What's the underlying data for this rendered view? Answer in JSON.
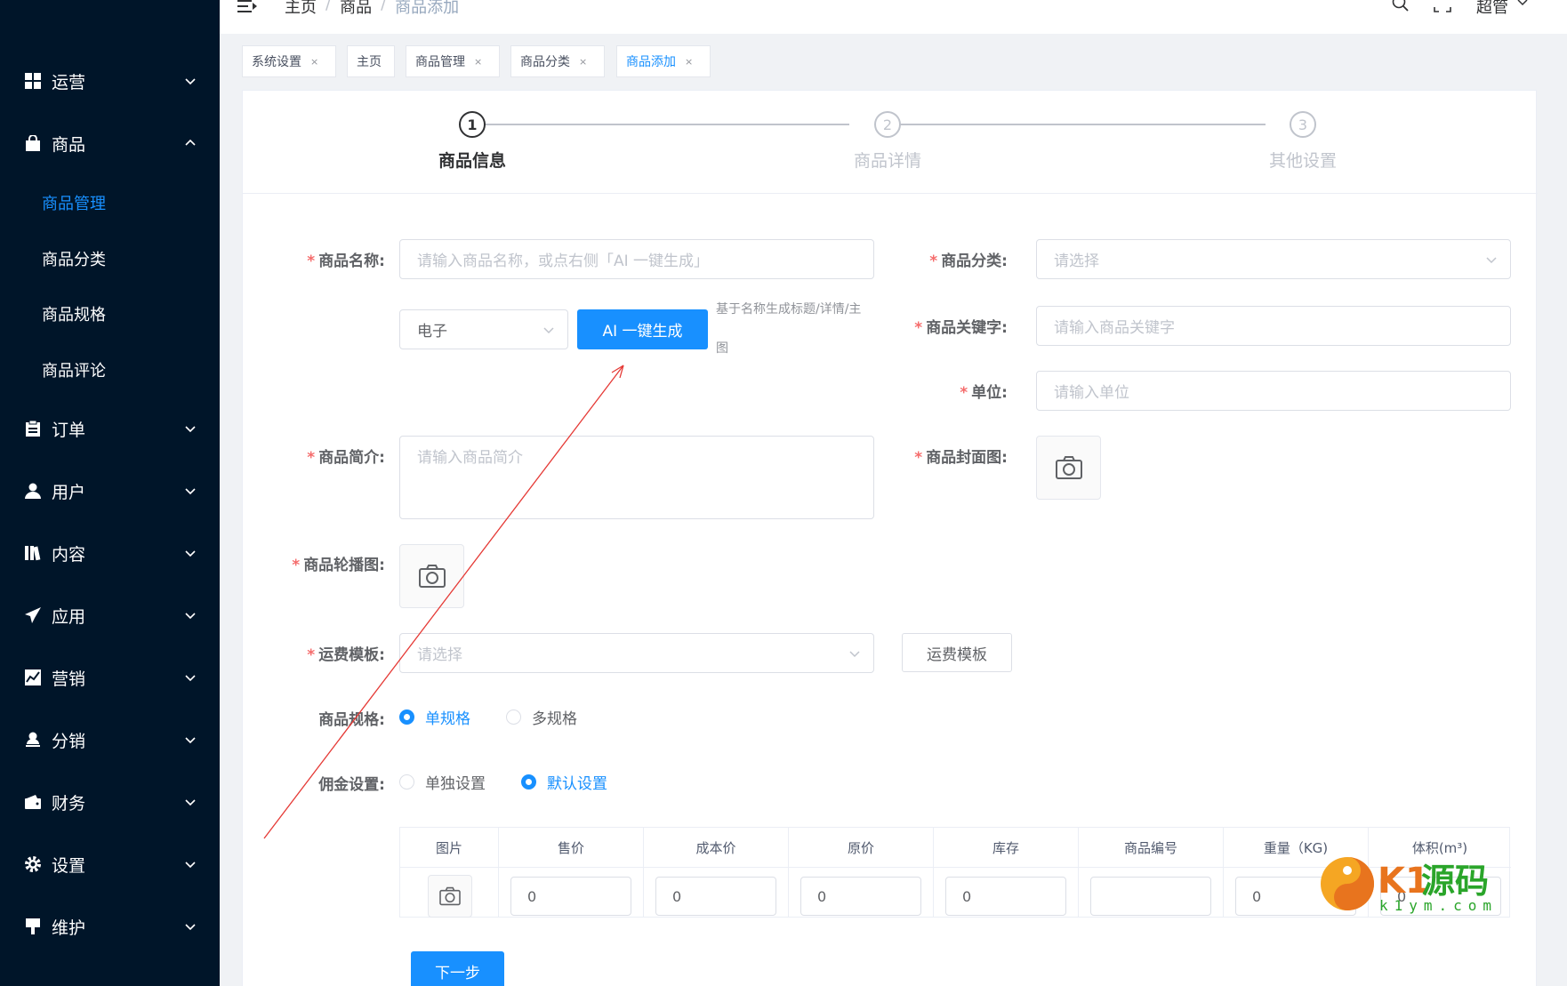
{
  "sidebar": {
    "menus": [
      {
        "label": "运营",
        "icon": "grid-icon"
      },
      {
        "label": "商品",
        "icon": "bag-icon"
      },
      {
        "label": "订单",
        "icon": "clipboard-icon"
      },
      {
        "label": "用户",
        "icon": "user-icon"
      },
      {
        "label": "内容",
        "icon": "book-icon"
      },
      {
        "label": "应用",
        "icon": "paper-plane-icon"
      },
      {
        "label": "营销",
        "icon": "chart-icon"
      },
      {
        "label": "分销",
        "icon": "person-stamp-icon"
      },
      {
        "label": "财务",
        "icon": "wallet-icon"
      },
      {
        "label": "设置",
        "icon": "gear-icon"
      },
      {
        "label": "维护",
        "icon": "tool-icon"
      }
    ],
    "submenu": [
      "商品管理",
      "商品分类",
      "商品规格",
      "商品评论"
    ]
  },
  "header": {
    "breadcrumb": [
      "主页",
      "商品",
      "商品添加"
    ],
    "user": "超管"
  },
  "tags": [
    {
      "label": "系统设置",
      "closable": true
    },
    {
      "label": "主页",
      "closable": false
    },
    {
      "label": "商品管理",
      "closable": true
    },
    {
      "label": "商品分类",
      "closable": true
    },
    {
      "label": "商品添加",
      "closable": true,
      "active": true
    }
  ],
  "steps": [
    {
      "num": "1",
      "title": "商品信息"
    },
    {
      "num": "2",
      "title": "商品详情"
    },
    {
      "num": "3",
      "title": "其他设置"
    }
  ],
  "form": {
    "name_label": "商品名称:",
    "name_placeholder": "请输入商品名称，或点右侧「AI 一键生成」",
    "ai_type_value": "电子",
    "ai_button": "AI 一键生成",
    "ai_hint_line1": "基于名称生成标题/详情/主",
    "ai_hint_line2": "图",
    "category_label": "商品分类:",
    "category_placeholder": "请选择",
    "keyword_label": "商品关键字:",
    "keyword_placeholder": "请输入商品关键字",
    "unit_label": "单位:",
    "unit_placeholder": "请输入单位",
    "intro_label": "商品简介:",
    "intro_placeholder": "请输入商品简介",
    "cover_label": "商品封面图:",
    "carousel_label": "商品轮播图:",
    "freight_label": "运费模板:",
    "freight_placeholder": "请选择",
    "freight_button": "运费模板",
    "spec_label": "商品规格:",
    "spec_single": "单规格",
    "spec_multi": "多规格",
    "commission_label": "佣金设置:",
    "commission_single": "单独设置",
    "commission_default": "默认设置",
    "next_button": "下一步"
  },
  "table": {
    "headers": [
      "图片",
      "售价",
      "成本价",
      "原价",
      "库存",
      "商品编号",
      "重量（KG)",
      "体积(m³)"
    ],
    "values": [
      "0",
      "0",
      "0",
      "0",
      "",
      "0",
      "0"
    ]
  },
  "watermark": {
    "text1": "K1源码",
    "text2": "k1ym.com"
  },
  "colors": {
    "primary": "#1890ff",
    "sidebar": "#001529",
    "required": "#f56c6c"
  }
}
